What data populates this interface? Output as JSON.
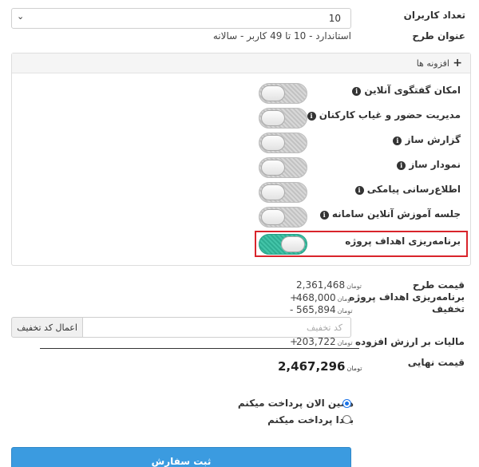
{
  "top": {
    "users_label": "تعداد کاربران",
    "users_value": "10",
    "plan_title_label": "عنوان طرح",
    "plan_title_value": "استاندارد - 10 تا 49 کاربر - سالانه"
  },
  "addons": {
    "header": "افزونه ها",
    "items": [
      {
        "name": "امکان گفتگوی آنلاین",
        "enabled": false
      },
      {
        "name": "مدیریت حضور و غیاب کارکنان",
        "enabled": false
      },
      {
        "name": "گزارش ساز",
        "enabled": false
      },
      {
        "name": "نمودار ساز",
        "enabled": false
      },
      {
        "name": "اطلاع‌رسانی پیامکی",
        "enabled": false
      },
      {
        "name": "جلسه آموزش آنلاین سامانه",
        "enabled": false
      },
      {
        "name": "برنامه‌ریزی اهداف پروژه",
        "enabled": true
      }
    ]
  },
  "pricing": {
    "plan_price_label": "قیمت طرح",
    "plan_price_value": "2,361,468",
    "addon_label": "برنامه‌ریزی اهداف پروژه",
    "addon_value": "468,000",
    "addon_sign": "+",
    "discount_label": "تخفیف",
    "discount_value": "565,894",
    "discount_sign": "-",
    "currency": "تومان",
    "discount_placeholder": "کد تخفیف",
    "discount_button": "اعمال کد تخفیف",
    "vat_label": "مالیات بر ارزش افزوده",
    "vat_value": "203,722",
    "vat_sign": "+",
    "total_label": "قیمت نهایی",
    "total_value": "2,467,296"
  },
  "payment": {
    "now_label": "همین الان پرداخت میکنم",
    "later_label": "بعدا پرداخت میکنم",
    "selected": "now"
  },
  "submit_label": "ثبت سفارش",
  "colors": {
    "toggle_on": "#2fae93",
    "highlight": "#d9242b",
    "submit": "#3b9be0"
  }
}
